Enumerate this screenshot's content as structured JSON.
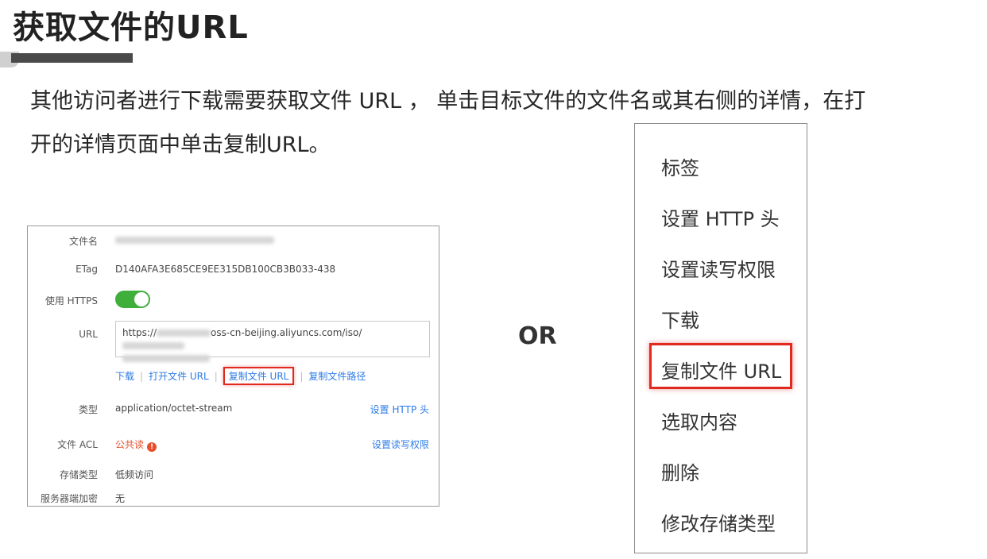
{
  "slide": {
    "title": "获取文件的URL",
    "intro_line1": "其他访问者进行下载需要获取文件 URL ， 单击目标文件的文件名或其右侧的详情，在打",
    "intro_line2": "开的详情页面中单击复制URL。",
    "or_label": "OR"
  },
  "panel": {
    "filename_label": "文件名",
    "etag_label": "ETag",
    "etag_value": "D140AFA3E685CE9EE315DB100CB3B033-438",
    "https_label": "使用 HTTPS",
    "https_enabled": true,
    "url_label": "URL",
    "url_prefix": "https://",
    "url_middle": "oss-cn-beijing.aliyuncs.com/iso/",
    "links": {
      "download": "下载",
      "open_url": "打开文件 URL",
      "copy_url": "复制文件 URL",
      "copy_path": "复制文件路径"
    },
    "type_label": "类型",
    "type_value": "application/octet-stream",
    "set_http_header": "设置 HTTP 头",
    "acl_label": "文件 ACL",
    "acl_value": "公共读",
    "set_rw_permission": "设置读写权限",
    "storage_label": "存储类型",
    "storage_value": "低频访问",
    "encryption_label": "服务器端加密",
    "encryption_value": "无"
  },
  "menu": {
    "items": [
      "标签",
      "设置 HTTP 头",
      "设置读写权限",
      "下载",
      "复制文件 URL",
      "选取内容",
      "删除",
      "修改存储类型"
    ],
    "highlighted": "复制文件 URL"
  },
  "colors": {
    "highlight": "#e02a20",
    "link": "#2c7be5",
    "toggle_on": "#3fae3b"
  }
}
